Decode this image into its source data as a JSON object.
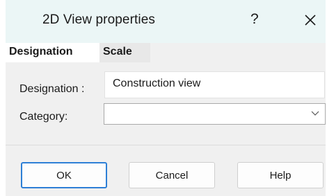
{
  "window": {
    "title": "2D View properties",
    "help_glyph": "?",
    "close_icon": "close-icon"
  },
  "tabs": [
    {
      "label": "Designation",
      "active": true
    },
    {
      "label": "Scale",
      "active": false
    }
  ],
  "form": {
    "designation_label": "Designation :",
    "designation_value": "Construction view",
    "category_label": "Category:",
    "category_value": "",
    "category_icon": "chevron-down-icon"
  },
  "buttons": {
    "ok": "OK",
    "cancel": "Cancel",
    "help": "Help"
  },
  "colors": {
    "titlebar_bg": "#ebf6f6",
    "dialog_bg": "#f0f0f0",
    "default_button_border": "#2d7fd6"
  }
}
